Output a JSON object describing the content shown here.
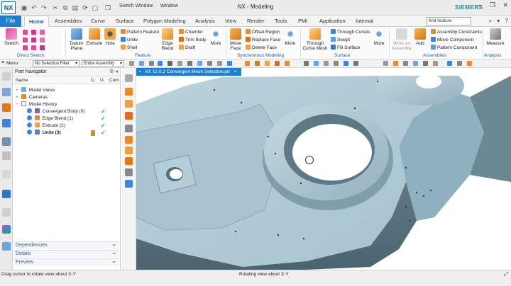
{
  "app": {
    "logo": "NX",
    "title": "NX - Modeling",
    "brand": "SIEMENS",
    "switch_window": "Switch Window",
    "window_menu": "Window",
    "accent": "#1e7fcf"
  },
  "menu": {
    "file": "File",
    "tabs": [
      "Home",
      "Assemblies",
      "Curve",
      "Surface",
      "Polygon Modeling",
      "Analysis",
      "View",
      "Render",
      "Tools",
      "PMI",
      "Application",
      "Internal"
    ],
    "active_tab": "Home",
    "search_value": "find feature"
  },
  "ribbon": {
    "sketch": "Sketch",
    "direct_sketch": "Direct Sketch",
    "datum_plane": "Datum Plane",
    "extrude": "Extrude",
    "hole": "Hole",
    "pattern_feature": "Pattern Feature",
    "unite": "Unite",
    "shell": "Shell",
    "edge_blend": "Edge Blend",
    "chamfer": "Chamfer",
    "trim_body": "Trim Body",
    "draft": "Draft",
    "more1": "More",
    "feature_group": "Feature",
    "move_face": "Move Face",
    "offset_region": "Offset Region",
    "replace_face": "Replace Face",
    "delete_face": "Delete Face",
    "more2": "More",
    "sync_group": "Synchronous Modeling",
    "through_curve_mesh": "Through Curve Mesh",
    "through_curves": "Through Curves",
    "swept": "Swept",
    "fill_surface": "Fill Surface",
    "more3": "More",
    "surface_group": "Surface",
    "work_on_assembly": "Work on Assembly",
    "add": "Add",
    "assembly_constraints": "Assembly Constraints",
    "move_component": "Move Component",
    "pattern_component": "Pattern Component",
    "assemblies_group": "Assemblies",
    "measure": "Measure",
    "analysis_group": "Analysis"
  },
  "selbar": {
    "menu": "Menu",
    "filter": "No Selection Filter",
    "scope": "Entire Assembly"
  },
  "navigator": {
    "title": "Part Navigator",
    "columns": [
      "Name",
      "C.",
      "U.",
      "Com"
    ],
    "rows": [
      {
        "label": "Model Views",
        "expander": "+"
      },
      {
        "label": "Cameras",
        "expander": "+"
      },
      {
        "label": "Model History",
        "expander": "−"
      },
      {
        "label": "Convergent Body (0)",
        "check": "✓"
      },
      {
        "label": "Edge Blend (1)",
        "check": "✓"
      },
      {
        "label": "Extrude (2)",
        "check": "✓"
      },
      {
        "label": "Unite (3)",
        "check": "✓"
      }
    ],
    "sections": [
      "Dependencies",
      "Details",
      "Preview"
    ]
  },
  "graphics": {
    "tab_title": "NX 12.0.2 Convergent Mesh Selection.prt",
    "tab_close": "×"
  },
  "status": {
    "left": "Drag cursor to rotate view about X-Y",
    "middle": "Rotating view about X-Y"
  }
}
